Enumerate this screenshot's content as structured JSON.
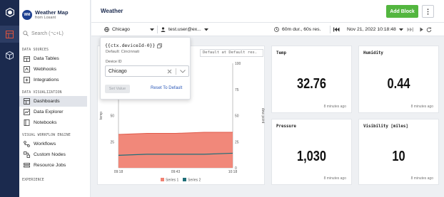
{
  "brand": {
    "logo_text": "WM",
    "app_name": "Weather Map",
    "subtitle": "from Losant"
  },
  "rail": {
    "icons": [
      "hexagon-logo-icon",
      "dashboard-grid-icon",
      "cube-icon"
    ]
  },
  "search": {
    "placeholder": "Search (⌥+L)"
  },
  "sidebar": {
    "sections": [
      {
        "title": "DATA SOURCES",
        "items": [
          {
            "label": "Data Tables",
            "icon": "table-icon"
          },
          {
            "label": "Webhooks",
            "icon": "webhook-icon"
          },
          {
            "label": "Integrations",
            "icon": "integrations-icon"
          }
        ]
      },
      {
        "title": "DATA VISUALIZATION",
        "items": [
          {
            "label": "Dashboards",
            "icon": "dashboard-icon",
            "active": true
          },
          {
            "label": "Data Explorer",
            "icon": "explorer-icon"
          },
          {
            "label": "Notebooks",
            "icon": "notebook-icon"
          }
        ]
      },
      {
        "title": "VISUAL WORKFLOW ENGINE",
        "items": [
          {
            "label": "Workflows",
            "icon": "workflow-icon"
          },
          {
            "label": "Custom Nodes",
            "icon": "custom-node-icon"
          },
          {
            "label": "Resource Jobs",
            "icon": "resource-job-icon"
          }
        ]
      },
      {
        "title": "EXPERIENCE",
        "items": []
      }
    ]
  },
  "header": {
    "title": "Weather",
    "add_block_label": "Add Block"
  },
  "toolbar": {
    "context_value": "Chicago",
    "user_value": "test.user@ex...",
    "duration_value": "60m dur., 60s res.",
    "date_value": "Nov 21, 2022 10:18:48"
  },
  "popover": {
    "variable": "{{ctx.deviceId-0}}",
    "default_text": "Default: Cincinnati",
    "field_label": "Device ID",
    "selected_value": "Chicago",
    "set_value_label": "Set Value",
    "reset_label": "Reset To Default"
  },
  "chart_panel": {
    "title_field": "Default at Default res."
  },
  "chart_data": {
    "type": "area",
    "x": [
      "09:18",
      "09:43",
      "10:18"
    ],
    "series": [
      {
        "name": "Series 1",
        "color": "#f08273",
        "axis": "left",
        "values": [
          32,
          33,
          33,
          34,
          34
        ]
      },
      {
        "name": "Series 2",
        "color": "#1f6e78",
        "axis": "right",
        "values": [
          12,
          13,
          13,
          13,
          14
        ]
      }
    ],
    "ylabel": "temp",
    "ylabel_right": "dew point",
    "ylim": [
      0,
      100
    ],
    "yticks": [
      0,
      25,
      50,
      75,
      100
    ],
    "visible_yticks": [
      "25",
      "50"
    ],
    "right_ticks": [
      "100",
      "75",
      "50",
      "25",
      "0"
    ],
    "legend_position": "bottom"
  },
  "stats": [
    {
      "label": "Temp",
      "value": "32.76",
      "time": "8 minutes ago"
    },
    {
      "label": "Humidity",
      "value": "0.44",
      "time": "8 minutes ago"
    },
    {
      "label": "Pressure",
      "value": "1,030",
      "time": "8 minutes ago"
    },
    {
      "label": "Visibility [miles]",
      "value": "10",
      "time": "8 minutes ago"
    }
  ]
}
